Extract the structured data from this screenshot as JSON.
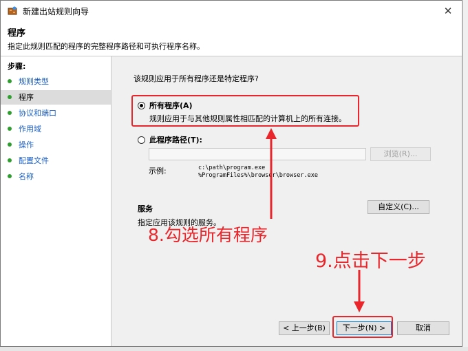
{
  "window": {
    "title": "新建出站规则向导",
    "close_glyph": "✕"
  },
  "header": {
    "title": "程序",
    "subtitle": "指定此规则匹配的程序的完整程序路径和可执行程序名称。"
  },
  "sidebar": {
    "heading": "步骤:",
    "items": [
      {
        "label": "规则类型"
      },
      {
        "label": "程序"
      },
      {
        "label": "协议和端口"
      },
      {
        "label": "作用域"
      },
      {
        "label": "操作"
      },
      {
        "label": "配置文件"
      },
      {
        "label": "名称"
      }
    ]
  },
  "main": {
    "question": "该规则应用于所有程序还是特定程序?",
    "all_programs": {
      "label": "所有程序(A)",
      "description": "规则应用于与其他规则属性相匹配的计算机上的所有连接。",
      "selected": true
    },
    "this_program": {
      "label": "此程序路径(T):",
      "value": "",
      "selected": false
    },
    "browse_button": "浏览(R)...",
    "example_label": "示例:",
    "example_lines": [
      "c:\\path\\program.exe",
      "%ProgramFiles%\\browser\\browser.exe"
    ],
    "services": {
      "title": "服务",
      "description": "指定应用该规则的服务。",
      "customize_button": "自定义(C)..."
    }
  },
  "footer": {
    "back_button": "< 上一步(B)",
    "next_button": "下一步(N) >",
    "cancel_button": "取消"
  },
  "annotations": {
    "step8": "8.勾选所有程序",
    "step9": "9.点击下一步",
    "color": "#e8262b"
  }
}
